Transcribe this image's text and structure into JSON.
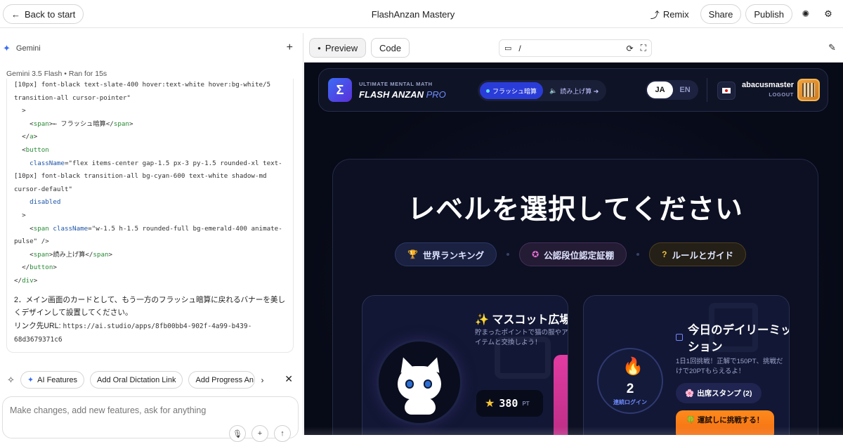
{
  "topbar": {
    "back_label": "Back to start",
    "app_title": "FlashAnzan Mastery",
    "remix_label": "Remix",
    "share_label": "Share",
    "publish_label": "Publish"
  },
  "chat": {
    "assistant_name": "Gemini",
    "model_line": "Gemini 3.5 Flash  •  Ran for 15s",
    "code_lines": [
      "[10px] font-black text-slate-400 hover:text-white hover:bg-white/5",
      "transition-all cursor-pointer\"",
      "  >",
      "    <span>← フラッシュ暗算</span>",
      "  </a>",
      "  <button",
      "    className=\"flex items-center gap-1.5 px-3 py-1.5 rounded-xl text-",
      "[10px] font-black transition-all bg-cyan-600 text-white shadow-md",
      "cursor-default\"",
      "    disabled",
      "  >",
      "    <span className=\"w-1.5 h-1.5 rounded-full bg-emerald-400 animate-",
      "pulse\" />",
      "    <span>読み上げ算</span>",
      "  </button>",
      "</div>"
    ],
    "message_text": "2．メイン画面のカードとして、もう一方のフラッシュ暗算に戻れるバナーを美しくデザインして設置してください。",
    "link_prefix": "リンク先URL: ",
    "link_url": "https://ai.studio/apps/8fb00bb4-902f-4a99-b439-68d3679371c6",
    "chips": [
      "AI Features",
      "Add Oral Dictation Link",
      "Add Progress An"
    ],
    "input_placeholder": "Make changes, add new features, ask for anything"
  },
  "preview": {
    "tab_preview": "Preview",
    "tab_code": "Code",
    "url_path": "/"
  },
  "app": {
    "brand_sub": "ULTIMATE MENTAL MATH",
    "brand_main": "FLASH ANZAN",
    "brand_pro": "PRO",
    "logo_symbol": "Σ",
    "mode_active": "フラッシュ暗算",
    "mode_other": "読み上げ算 ➔",
    "lang_active": "JA",
    "lang_other": "EN",
    "username": "abacusmaster",
    "logout": "LOGOUT",
    "headline": "レベルを選択してください",
    "pills": [
      "世界ランキング",
      "公認段位認定証棚",
      "ルールとガイド"
    ],
    "mascot_title": "マスコット広場",
    "mascot_desc": "貯まったポイントで猫の服やアイテムと交換しよう！",
    "points_value": "380",
    "points_unit": "PT",
    "daily_title": "今日のデイリーミッション",
    "daily_desc": "1日1回挑戦！正解で150PT、挑戦だけで20PTもらえるよ！",
    "streak_num": "2",
    "streak_label": "連続ログイン",
    "stamp_label": "出席スタンプ (2)",
    "challenge_label": "運試しに挑戦する！"
  }
}
